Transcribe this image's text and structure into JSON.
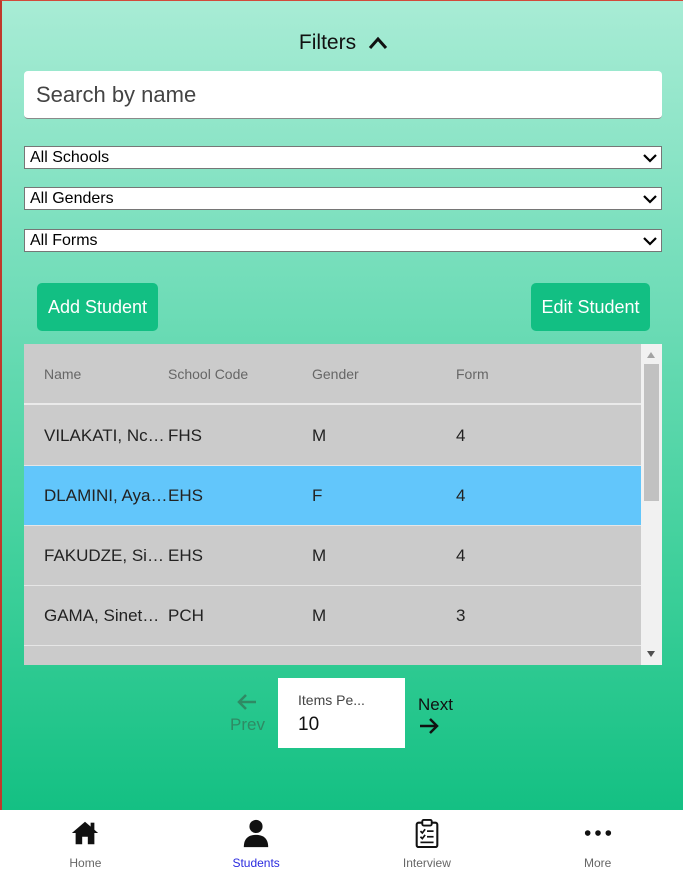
{
  "filters": {
    "title": "Filters",
    "search_placeholder": "Search by name",
    "school_select": "All Schools",
    "gender_select": "All Genders",
    "form_select": "All Forms"
  },
  "actions": {
    "add_label": "Add Student",
    "edit_label": "Edit Student"
  },
  "table": {
    "columns": [
      "Name",
      "School Code",
      "Gender",
      "Form"
    ],
    "rows": [
      {
        "name": "VILAKATI, Ncedo",
        "school": "FHS",
        "gender": "M",
        "form": "4"
      },
      {
        "name": "DLAMINI, Ayanda",
        "school": "EHS",
        "gender": "F",
        "form": "4"
      },
      {
        "name": "FAKUDZE, Sibon...",
        "school": "EHS",
        "gender": "M",
        "form": "4"
      },
      {
        "name": "GAMA, Sinethem...",
        "school": "PCH",
        "gender": "M",
        "form": "3"
      }
    ]
  },
  "pager": {
    "prev_label": "Prev",
    "next_label": "Next",
    "items_per_label": "Items Pe...",
    "items_per_value": "10"
  },
  "nav": {
    "items": [
      {
        "label": "Home",
        "icon": "home-icon"
      },
      {
        "label": "Students",
        "icon": "person-icon"
      },
      {
        "label": "Interview",
        "icon": "clipboard-icon"
      },
      {
        "label": "More",
        "icon": "more-icon"
      }
    ]
  },
  "colors": {
    "accent": "#12bf83",
    "selected_row": "#62c6fb",
    "active_nav": "#2a2adf"
  }
}
